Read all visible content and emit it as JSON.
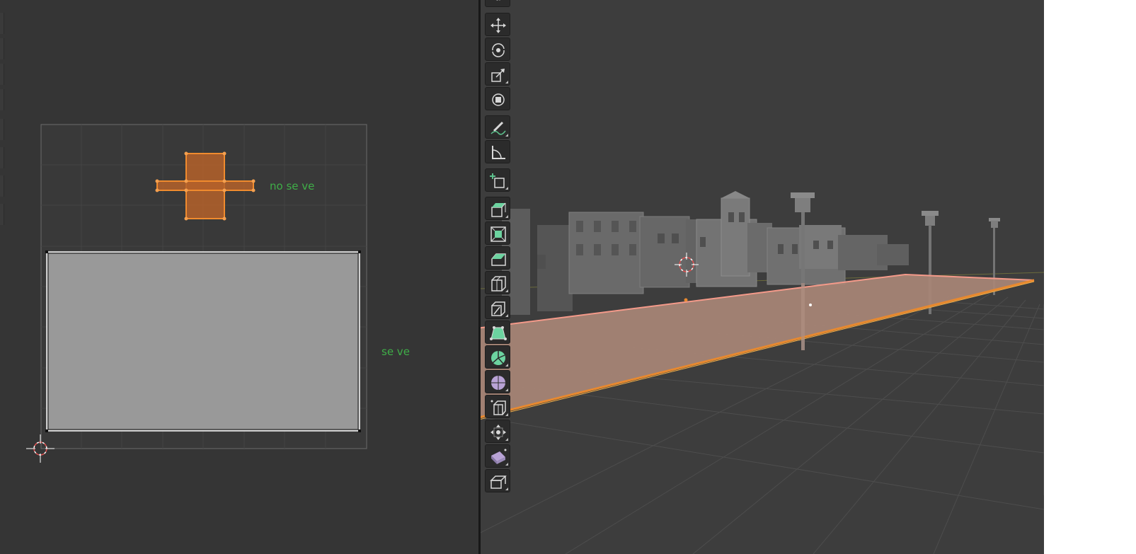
{
  "uv_editor": {
    "annotations": {
      "not_visible": "no se ve",
      "visible": "se ve"
    }
  },
  "viewport": {},
  "toolbar": {
    "tools": [
      {
        "name": "move-tool",
        "icon": "move-icon"
      },
      {
        "name": "rotate-tool",
        "icon": "rotate-icon"
      },
      {
        "name": "scale-tool",
        "icon": "scale-icon"
      },
      {
        "name": "transform-tool",
        "icon": "transform-icon"
      },
      {
        "name": "annotate-tool",
        "icon": "annotate-icon"
      },
      {
        "name": "measure-tool",
        "icon": "measure-icon"
      },
      {
        "name": "add-cube-tool",
        "icon": "add-cube-icon"
      },
      {
        "name": "extrude-region-tool",
        "icon": "extrude-region-icon"
      },
      {
        "name": "inset-faces-tool",
        "icon": "inset-faces-icon"
      },
      {
        "name": "bevel-tool",
        "icon": "bevel-icon"
      },
      {
        "name": "loop-cut-tool",
        "icon": "loop-cut-icon"
      },
      {
        "name": "knife-tool",
        "icon": "knife-icon"
      },
      {
        "name": "poly-build-tool",
        "icon": "poly-build-icon"
      },
      {
        "name": "spin-tool",
        "icon": "spin-icon"
      },
      {
        "name": "smooth-tool",
        "icon": "smooth-icon"
      },
      {
        "name": "edge-slide-tool",
        "icon": "edge-slide-icon"
      },
      {
        "name": "shrink-fatten-tool",
        "icon": "shrink-fatten-icon"
      },
      {
        "name": "shear-tool",
        "icon": "shear-icon"
      },
      {
        "name": "rip-region-tool",
        "icon": "rip-region-icon"
      }
    ]
  },
  "colors": {
    "uv_background": "#353535",
    "viewport_background": "#3d3d3d",
    "selection_orange": "#e8892f",
    "annotation_green": "#3fae48",
    "plane_face": "#a88576"
  }
}
